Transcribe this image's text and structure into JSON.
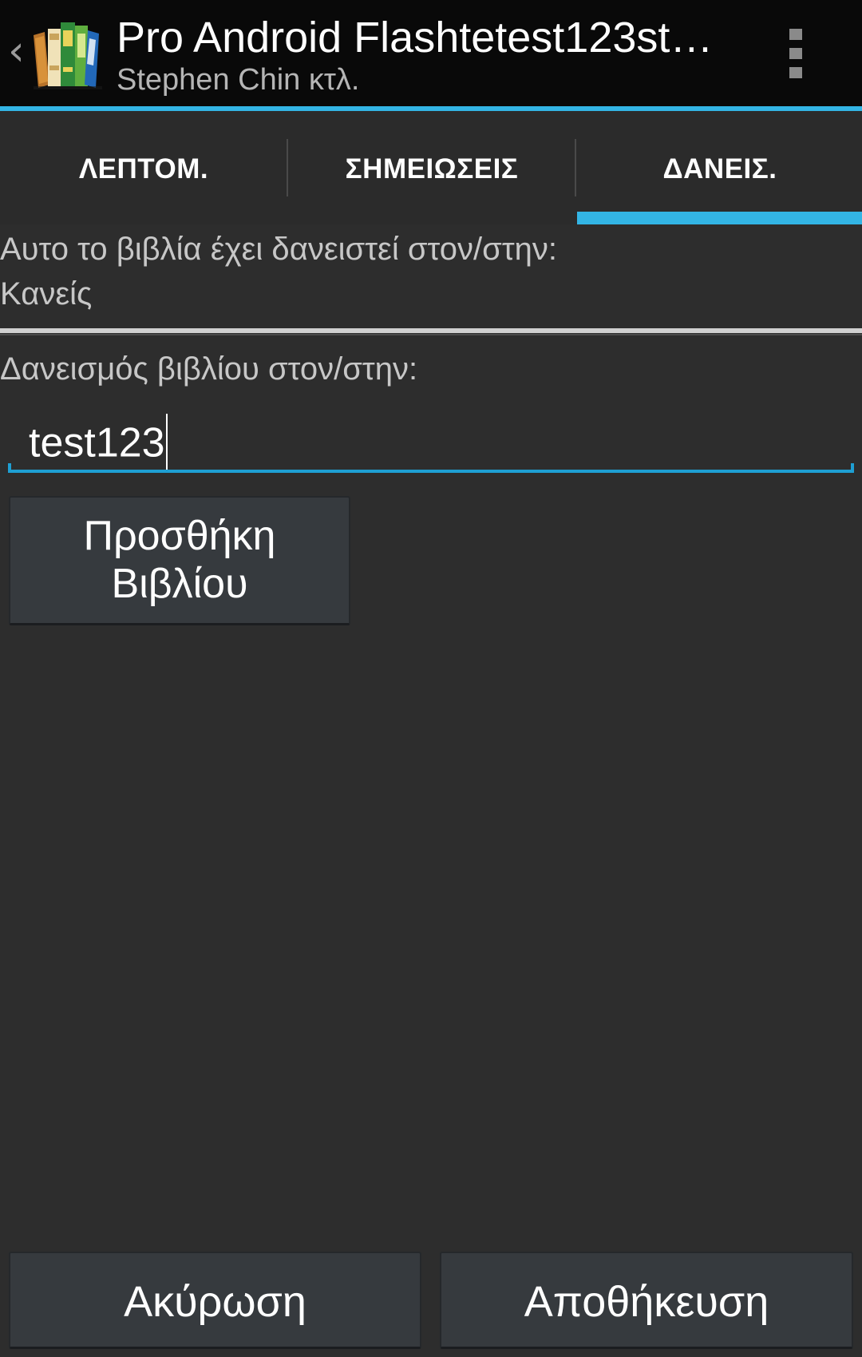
{
  "action_bar": {
    "title": "Pro Android Flashtetest123st…",
    "subtitle": "Stephen Chin κτλ.",
    "up_caret": "‹",
    "app_icon": "books-icon",
    "overflow_icon": "overflow-menu-icon"
  },
  "tabs": [
    {
      "label": "ΛΕΠΤΟΜ.",
      "selected": false
    },
    {
      "label": "ΣΗΜΕΙΩΣΕΙΣ",
      "selected": false
    },
    {
      "label": "ΔΑΝΕΙΣ.",
      "selected": true
    }
  ],
  "loan": {
    "lent_to_label": "Αυτο το βιβλία έχει δανειστεί στον/στην:",
    "lent_to_value": "Κανείς",
    "lend_label": "Δανεισμός βιβλίου στον/στην:",
    "input_value": "test123",
    "add_button_line1": "Προσθήκη",
    "add_button_line2": "Βιβλίου"
  },
  "footer": {
    "cancel_label": "Ακύρωση",
    "save_label": "Αποθήκευση"
  },
  "colors": {
    "accent": "#33b5e5",
    "background": "#2d2d2d",
    "action_bar": "#090909"
  }
}
